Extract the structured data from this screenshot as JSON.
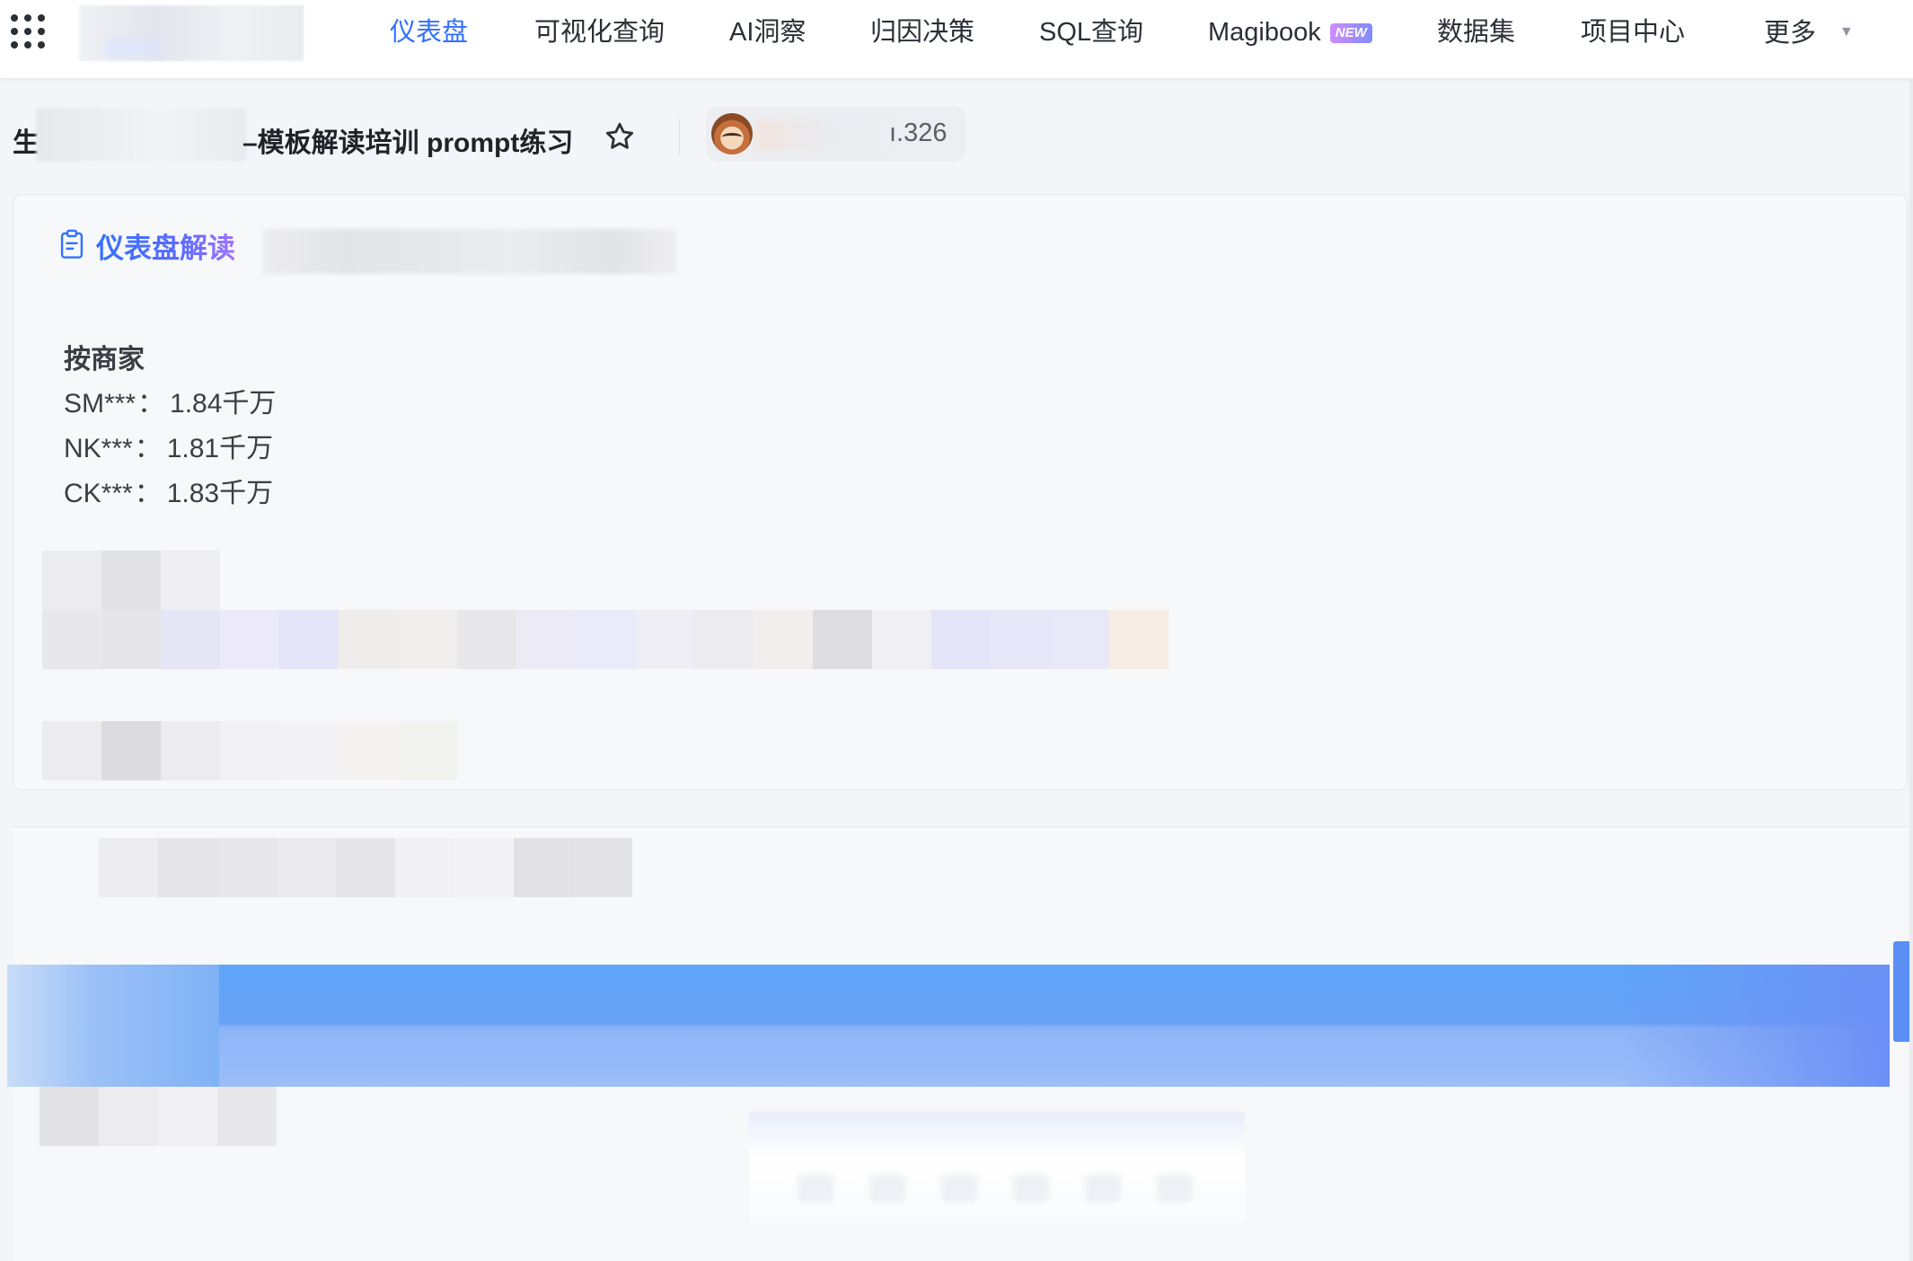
{
  "nav": {
    "items": [
      {
        "label": "仪表盘",
        "active": true
      },
      {
        "label": "可视化查询"
      },
      {
        "label": "AI洞察"
      },
      {
        "label": "归因决策"
      },
      {
        "label": "SQL查询"
      },
      {
        "label": "Magibook",
        "badge": "NEW"
      },
      {
        "label": "数据集"
      },
      {
        "label": "项目中心"
      },
      {
        "label": "更多",
        "dropdown": true
      }
    ]
  },
  "dashboard": {
    "title_prefix": "生",
    "title_suffix": "–模板解读培训 prompt练习",
    "owner_suffix": "ı.326"
  },
  "insight": {
    "title": "仪表盘解读",
    "section_label": "按商家",
    "metrics": [
      {
        "name": "SM***",
        "sep": "：",
        "value": "1.84千万"
      },
      {
        "name": "NK***",
        "sep": "：",
        "value": "1.81千万"
      },
      {
        "name": "CK***",
        "sep": "：",
        "value": "1.83千万"
      }
    ]
  },
  "colors": {
    "accent": "#3370ff",
    "gradient_end": "#a072ff",
    "band_blue": "#5ea6f8"
  },
  "icons": {
    "app_grid": "app-grid-icon",
    "star": "star-icon",
    "clipboard": "clipboard-icon",
    "dropdown": "caret-down-icon"
  }
}
